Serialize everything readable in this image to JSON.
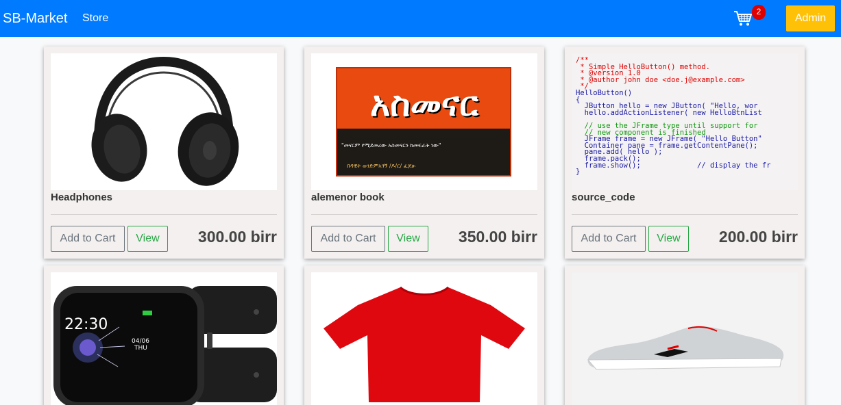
{
  "navbar": {
    "brand": "SB-Market",
    "store_link": "Store",
    "cart_icon": "shopping-cart-icon",
    "cart_count": "2",
    "admin_label": "Admin",
    "colors": {
      "primary": "#007bff",
      "warning": "#ffc107",
      "badge": "#e00000"
    }
  },
  "products": [
    {
      "name": "Headphones",
      "price": "300.00 birr",
      "add_label": "Add to Cart",
      "view_label": "View",
      "image": "headphones-image"
    },
    {
      "name": "alemenor book",
      "price": "350.00 birr",
      "add_label": "Add to Cart",
      "view_label": "View",
      "image": "book-cover-image",
      "cover_title": "አስመናር",
      "cover_line1": "\"መናርም የሚደመረው አስመናርን ከመፍራት ነው\"",
      "cover_line2": "በዳዊት ወንድምአገኝ /ዶ/ር/ ፈጆፁ"
    },
    {
      "name": "source_code",
      "price": "200.00 birr",
      "add_label": "Add to Cart",
      "view_label": "View",
      "image": "source-code-image",
      "code_lines": [
        "/**",
        " * Simple HelloButton() method.",
        " * @version 1.0",
        " * @author john doe <doe.j@example.com>",
        " */",
        "HelloButton()",
        "{",
        "  JButton hello = new JButton( \"Hello, wor",
        "  hello.addActionListener( new HelloBtnList",
        "",
        "  // use the JFrame type until support for",
        "  // new component is finished",
        "  JFrame frame = new JFrame( \"Hello Button\"",
        "  Container pane = frame.getContentPane();",
        "  pane.add( hello );",
        "  frame.pack();",
        "  frame.show();             // display the fr",
        "}"
      ]
    },
    {
      "name": "",
      "price": "",
      "image": "smartwatch-image",
      "watch_time": "22:30",
      "watch_date": "04/06",
      "watch_day": "THU"
    },
    {
      "name": "",
      "price": "",
      "image": "red-tshirt-image"
    },
    {
      "name": "",
      "price": "",
      "image": "sneaker-image"
    }
  ]
}
